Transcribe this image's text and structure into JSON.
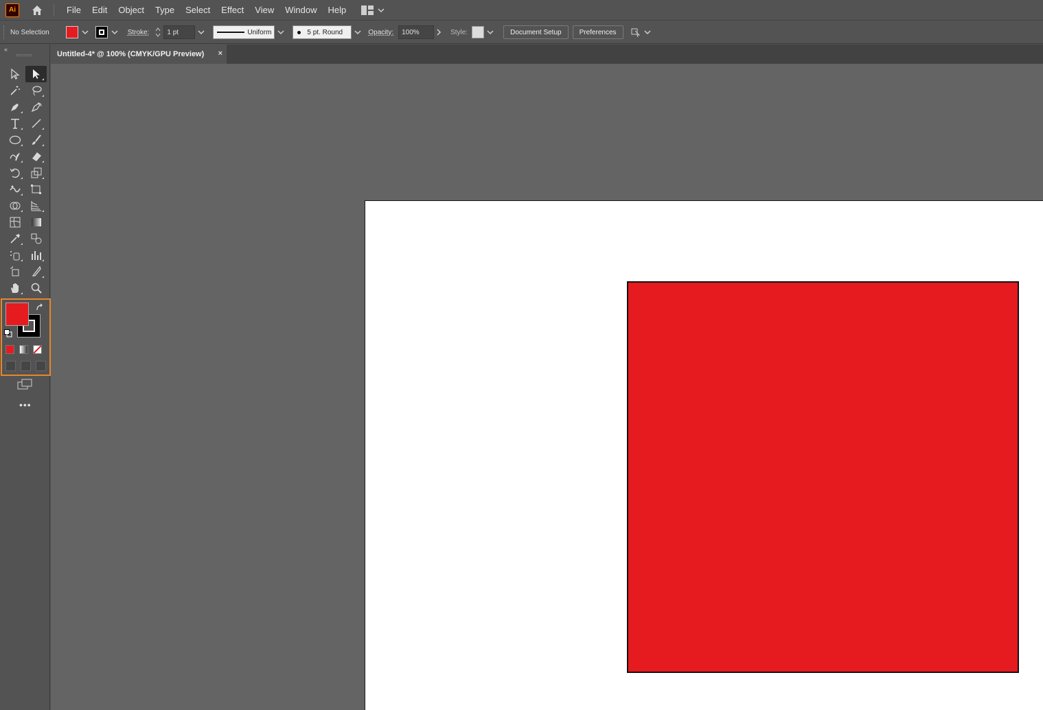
{
  "app": {
    "logo_text": "Ai"
  },
  "menu": [
    "File",
    "Edit",
    "Object",
    "Type",
    "Select",
    "Effect",
    "View",
    "Window",
    "Help"
  ],
  "control": {
    "selection_status": "No Selection",
    "stroke_label": "Stroke:",
    "stroke_weight": "1 pt",
    "stroke_profile": "Uniform",
    "brush": "5 pt. Round",
    "opacity_label": "Opacity:",
    "opacity_value": "100%",
    "style_label": "Style:",
    "document_setup": "Document Setup",
    "preferences": "Preferences"
  },
  "tab": {
    "title": "Untitled-4* @ 100% (CMYK/GPU Preview)",
    "close": "×"
  },
  "toolbar": {
    "collapse_glyph": "«",
    "more": "•••"
  },
  "colors": {
    "fill": "#e51b20",
    "stroke": "#000000",
    "accent": "#e8872b",
    "canvas_bg": "#646464",
    "ui_bg": "#535353"
  },
  "tools": [
    "selection-tool",
    "direct-selection-tool",
    "magic-wand-tool",
    "lasso-tool",
    "pen-tool",
    "curvature-tool",
    "type-tool",
    "line-segment-tool",
    "ellipse-tool",
    "paintbrush-tool",
    "shaper-tool",
    "eraser-tool",
    "rotate-tool",
    "scale-tool",
    "puppet-warp-tool",
    "free-transform-tool",
    "shape-builder-tool",
    "perspective-grid-tool",
    "mesh-tool",
    "gradient-tool",
    "eyedropper-tool",
    "blend-tool",
    "symbol-sprayer-tool",
    "column-graph-tool",
    "artboard-tool",
    "slice-tool",
    "hand-tool",
    "zoom-tool"
  ]
}
